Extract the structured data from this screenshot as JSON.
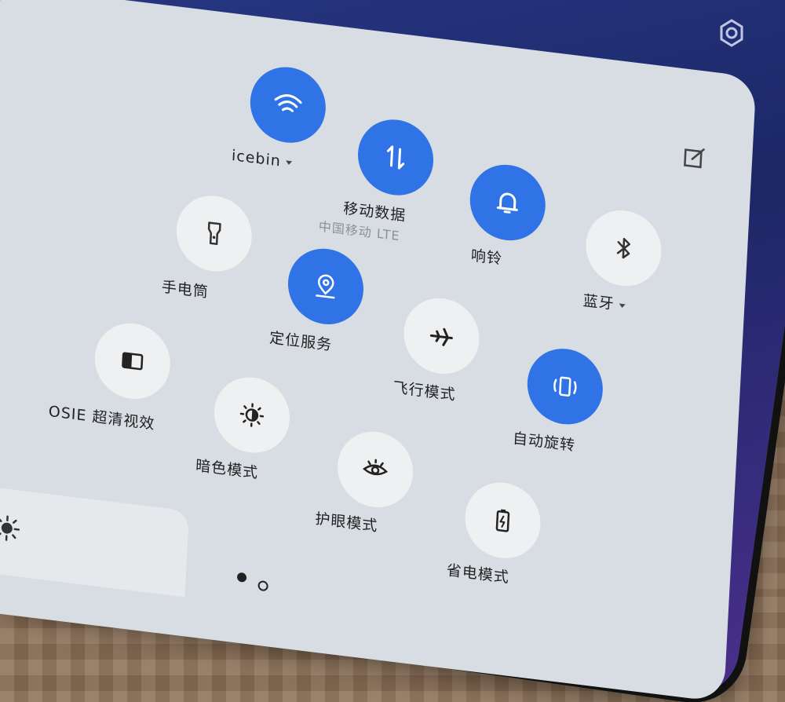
{
  "tiles": {
    "wifi": {
      "label": "icebin",
      "icon": "wifi-icon",
      "on": true
    },
    "mobile_data": {
      "label": "移动数据",
      "sublabel": "中国移动 LTE",
      "icon": "data-transfer-icon",
      "on": true
    },
    "ringer": {
      "label": "响铃",
      "icon": "bell-icon",
      "on": true
    },
    "bluetooth": {
      "label": "蓝牙",
      "icon": "bluetooth-icon",
      "on": false
    },
    "flashlight": {
      "label": "手电筒",
      "icon": "flashlight-icon",
      "on": false
    },
    "location": {
      "label": "定位服务",
      "icon": "location-icon",
      "on": true
    },
    "airplane": {
      "label": "飞行模式",
      "icon": "airplane-icon",
      "on": false
    },
    "rotation": {
      "label": "自动旋转",
      "icon": "rotate-icon",
      "on": true
    },
    "osie": {
      "label": "OSIE 超清视效",
      "icon": "osie-icon",
      "on": false
    },
    "dark": {
      "label": "暗色模式",
      "icon": "dark-mode-icon",
      "on": false
    },
    "eye": {
      "label": "护眼模式",
      "icon": "eye-icon",
      "on": false
    },
    "battery": {
      "label": "省电模式",
      "icon": "battery-saver-icon",
      "on": false
    }
  },
  "header": {
    "settings_icon": "gear-icon",
    "edit_icon": "edit-icon"
  },
  "brightness": {
    "icon": "brightness-icon"
  },
  "pager": {
    "pages": 2,
    "current": 1
  },
  "colors": {
    "accent": "#2f73e6",
    "tile_off": "#eef0f1",
    "panel": "#d7dde2"
  }
}
